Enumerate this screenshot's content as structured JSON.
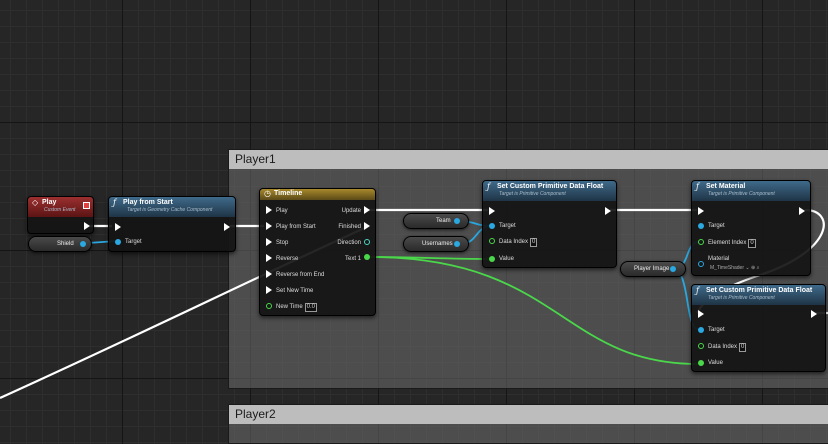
{
  "comments": {
    "player1": "Player1",
    "player2": "Player2"
  },
  "play_event": {
    "title": "Play",
    "subtitle": "Custom Event",
    "icon": "event-diamond-icon"
  },
  "shield_var": {
    "label": "Shield"
  },
  "play_from_start": {
    "title": "Play from Start",
    "subtitle": "Target is Geometry Cache Component",
    "target": "Target",
    "icon": "function-icon"
  },
  "timeline": {
    "title": "Timeline",
    "icon": "clock-icon",
    "inputs": [
      "Play",
      "Play from Start",
      "Stop",
      "Reverse",
      "Reverse from End",
      "Set New Time",
      "New Time"
    ],
    "new_time_value": "0.0",
    "outputs": [
      "Update",
      "Finished",
      "Direction",
      "Text 1"
    ]
  },
  "team_var": {
    "label": "Team"
  },
  "usernames_var": {
    "label": "Usernames"
  },
  "set_cpdf1": {
    "title": "Set Custom Primitive Data Float",
    "subtitle": "Target is Primitive Component",
    "target": "Target",
    "data_index": "Data Index",
    "data_index_value": "0",
    "value": "Value"
  },
  "player_image_var": {
    "label": "Player Image"
  },
  "set_material": {
    "title": "Set Material",
    "subtitle": "Target is Primitive Component",
    "target": "Target",
    "element_index": "Element Index",
    "element_index_value": "0",
    "material": "Material",
    "material_value": "M_TimeShader"
  },
  "set_cpdf2": {
    "title": "Set Custom Primitive Data Float",
    "subtitle": "Target is Primitive Component",
    "target": "Target",
    "data_index": "Data Index",
    "data_index_value": "0",
    "value": "Value"
  },
  "colors": {
    "exec_wire": "#ffffff",
    "object_wire": "#2aa8e0",
    "float_wire": "#4ad84a",
    "function_header": "#2f516d",
    "event_header": "#8a2424",
    "timeline_header": "#8a7024"
  }
}
